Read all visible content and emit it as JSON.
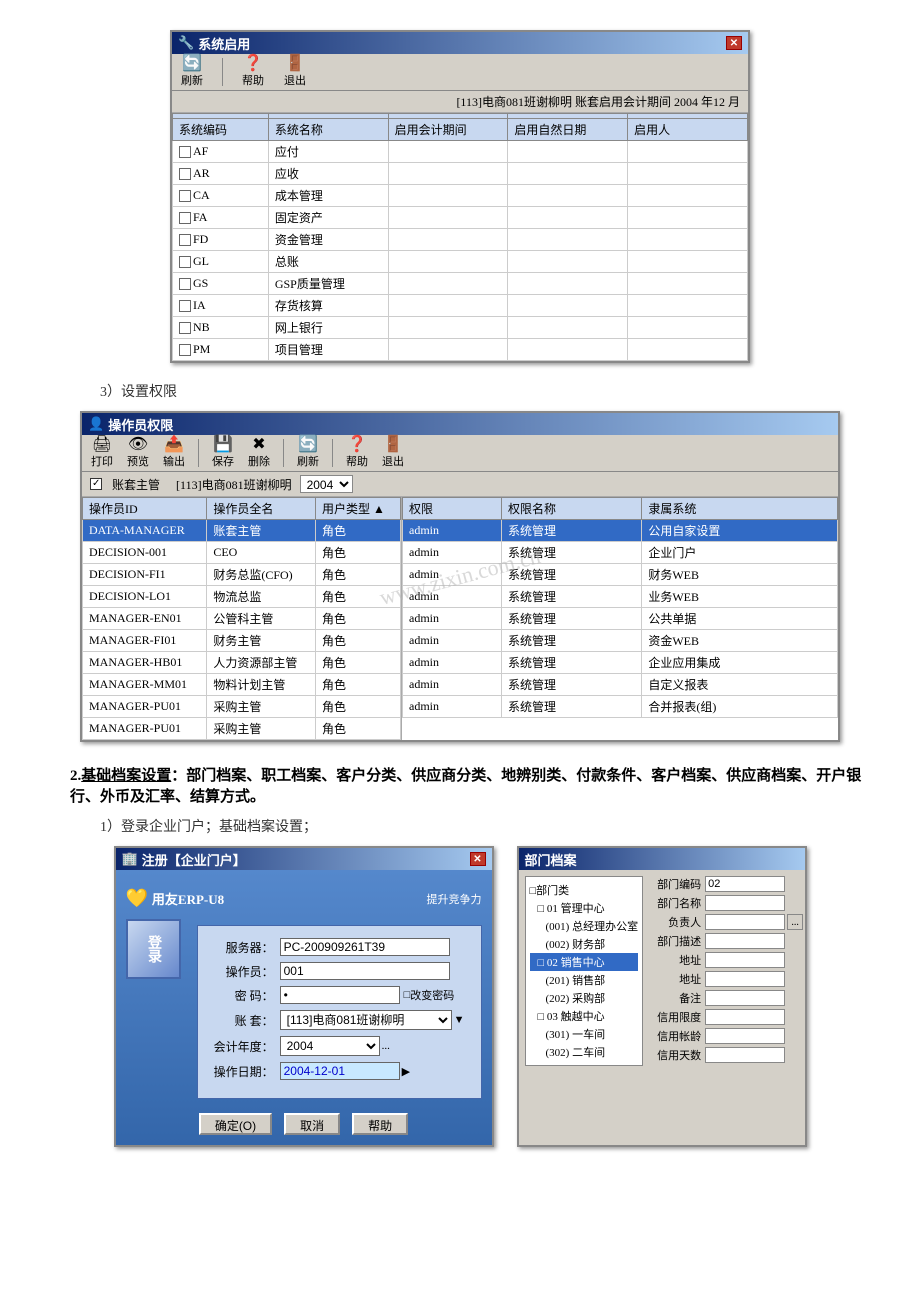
{
  "page": {
    "section1_label": "3）设置权限",
    "section2_label": "2.",
    "section2_bold": "基础档案设置",
    "section2_text": "：部门档案、职工档案、客户分类、供应商分类、地辨别类、付款条件、客户档案、供应商档案、开户银行、外币及汇率、结算方式。",
    "section3_label": "1）登录企业门户；基础档案设置；"
  },
  "sysEnable": {
    "title": "系统启用",
    "toolbar": {
      "refresh": "刷新",
      "help": "帮助",
      "exit": "退出"
    },
    "infobar": "[113]电商081班谢柳明  账套启用会计期间  2004 年12 月",
    "columns": [
      "系统编码",
      "系统名称",
      "启用会计期间",
      "启用自然日期",
      "启用人"
    ],
    "rows": [
      {
        "code": "AF",
        "name": "应付",
        "period": "",
        "date": "",
        "user": ""
      },
      {
        "code": "AR",
        "name": "应收",
        "period": "",
        "date": "",
        "user": ""
      },
      {
        "code": "CA",
        "name": "成本管理",
        "period": "",
        "date": "",
        "user": ""
      },
      {
        "code": "FA",
        "name": "固定资产",
        "period": "",
        "date": "",
        "user": ""
      },
      {
        "code": "FD",
        "name": "资金管理",
        "period": "",
        "date": "",
        "user": ""
      },
      {
        "code": "GL",
        "name": "总账",
        "period": "",
        "date": "",
        "user": ""
      },
      {
        "code": "GS",
        "name": "GSP质量管理",
        "period": "",
        "date": "",
        "user": ""
      },
      {
        "code": "IA",
        "name": "存货核算",
        "period": "",
        "date": "",
        "user": ""
      },
      {
        "code": "NB",
        "name": "网上银行",
        "period": "",
        "date": "",
        "user": ""
      },
      {
        "code": "PM",
        "name": "项目管理",
        "period": "",
        "date": "",
        "user": ""
      }
    ]
  },
  "operator": {
    "title": "操作员权限",
    "toolbar": {
      "print": "打印",
      "preview": "预览",
      "output": "输出",
      "save": "保存",
      "delete": "删除",
      "refresh": "刷新",
      "help": "帮助",
      "exit": "退出"
    },
    "checkbox_label": "账套主管",
    "account_label": "[113]电商081班谢柳明",
    "year": "2004",
    "left_columns": [
      "操作员ID",
      "操作员全名",
      "用户类型"
    ],
    "left_rows": [
      {
        "id": "DATA-MANAGER",
        "name": "账套主管",
        "type": "角色",
        "selected": true
      },
      {
        "id": "DECISION-001",
        "name": "CEO",
        "type": "角色"
      },
      {
        "id": "DECISION-FI1",
        "name": "财务总监(CFO)",
        "type": "角色"
      },
      {
        "id": "DECISION-LO1",
        "name": "物流总监",
        "type": "角色"
      },
      {
        "id": "MANAGER-EN01",
        "name": "公管科主管",
        "type": "角色"
      },
      {
        "id": "MANAGER-FI01",
        "name": "财务主管",
        "type": "角色"
      },
      {
        "id": "MANAGER-HB01",
        "name": "人力资源部主管",
        "type": "角色"
      },
      {
        "id": "MANAGER-MM01",
        "name": "物料计划主管",
        "type": "角色"
      },
      {
        "id": "MANAGER-PU01",
        "name": "采购主管",
        "type": "角色"
      },
      {
        "id": "MANAGER-PU01",
        "name": "采购主管",
        "type": "角色"
      }
    ],
    "right_columns": [
      "权限",
      "权限名称",
      "隶属系统"
    ],
    "right_rows": [
      {
        "perm": "admin",
        "name": "系统管理",
        "system": "公用自家设置",
        "selected": true
      },
      {
        "perm": "admin",
        "name": "系统管理",
        "system": "企业门户"
      },
      {
        "perm": "admin",
        "name": "系统管理",
        "system": "财务WEB"
      },
      {
        "perm": "admin",
        "name": "系统管理",
        "system": "业务WEB"
      },
      {
        "perm": "admin",
        "name": "系统管理",
        "system": "公共单据"
      },
      {
        "perm": "admin",
        "name": "系统管理",
        "system": "资金WEB"
      },
      {
        "perm": "admin",
        "name": "系统管理",
        "system": "企业应用集成"
      },
      {
        "perm": "admin",
        "name": "系统管理",
        "system": "自定义报表"
      },
      {
        "perm": "admin",
        "name": "系统管理",
        "system": "合并报表(组)"
      }
    ]
  },
  "login": {
    "title": "注册【企业门户】",
    "logo_text": "用友ERP-U8",
    "subtitle": "提升竞争力",
    "server_label": "服务器：",
    "server_value": "PC-200909261T39",
    "user_label": "操作员：",
    "user_value": "001",
    "pwd_label": "密  码：",
    "pwd_value": "*",
    "change_pwd": "改变密码",
    "account_label": "账  套：",
    "account_value": "[113]电商081班谢柳明",
    "year_label": "会计年度：",
    "year_value": "2004",
    "date_label": "操作日期：",
    "date_value": "2004-12-01",
    "btn_ok": "确定(O)",
    "btn_cancel": "取消",
    "btn_help": "帮助",
    "login_img_text": "登录"
  },
  "dept": {
    "title": "部门档案",
    "tree_items": [
      {
        "label": "□部门类",
        "level": 0
      },
      {
        "label": "□ 01 管理中心",
        "level": 1
      },
      {
        "label": "  (001) 总经理办公室",
        "level": 2
      },
      {
        "label": "  (002) 财务部",
        "level": 2
      },
      {
        "label": "□ 02 销售中心",
        "level": 1,
        "selected": true
      },
      {
        "label": "  (201) 销售部",
        "level": 2
      },
      {
        "label": "  (202) 采购部",
        "level": 2
      },
      {
        "label": "□ 03 触越中心",
        "level": 1
      },
      {
        "label": "  (301) 一车间",
        "level": 2
      },
      {
        "label": "  (302) 二车间",
        "level": 2
      }
    ],
    "form_rows": [
      {
        "label": "部门编码",
        "value": "02"
      },
      {
        "label": "部门名称",
        "value": ""
      },
      {
        "label": "负责人",
        "value": ""
      },
      {
        "label": "部门描述",
        "value": ""
      },
      {
        "label": "地址",
        "value": ""
      },
      {
        "label": "地址",
        "value": ""
      },
      {
        "label": "备注",
        "value": ""
      },
      {
        "label": "信用限度",
        "value": ""
      },
      {
        "label": "信用帐龄",
        "value": ""
      },
      {
        "label": "信用天数",
        "value": ""
      }
    ]
  },
  "icons": {
    "folder": "📁",
    "refresh": "🔄",
    "help": "❓",
    "exit": "🚪",
    "print": "🖨",
    "preview": "👁",
    "output": "📤",
    "save": "💾",
    "delete": "✖",
    "computer": "💻",
    "close": "✕"
  }
}
